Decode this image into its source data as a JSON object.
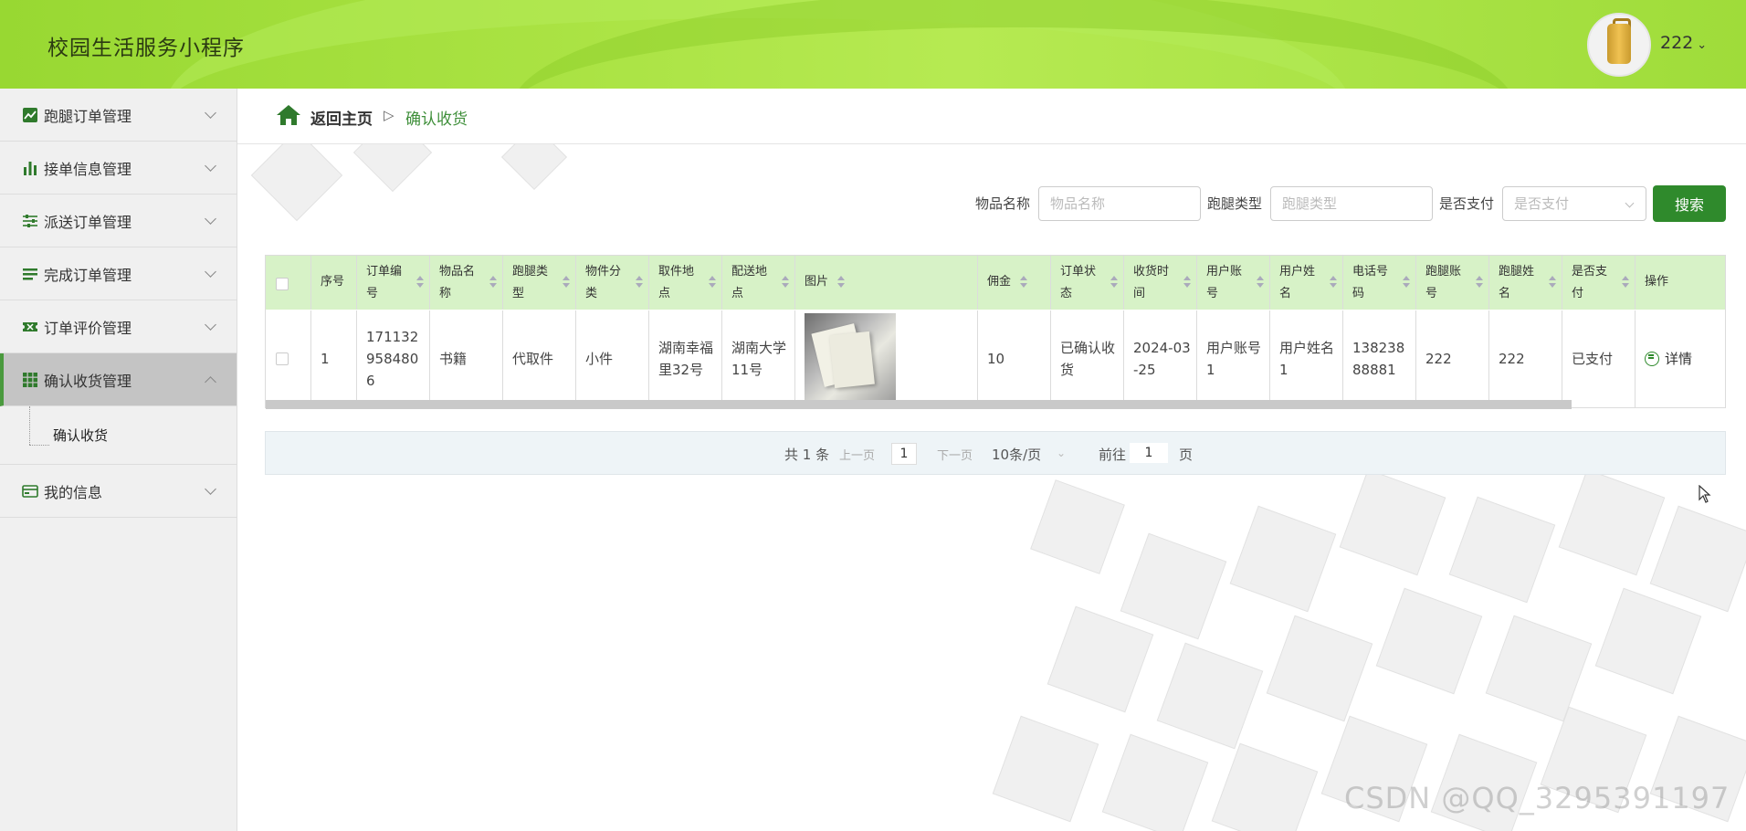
{
  "app": {
    "title": "校园生活服务小程序",
    "user": "222"
  },
  "sidebar": {
    "items": [
      {
        "label": "跑腿订单管理",
        "icon": "chart-line-icon"
      },
      {
        "label": "接单信息管理",
        "icon": "bar-chart-icon"
      },
      {
        "label": "派送订单管理",
        "icon": "sliders-icon"
      },
      {
        "label": "完成订单管理",
        "icon": "list-icon"
      },
      {
        "label": "订单评价管理",
        "icon": "ticket-icon"
      },
      {
        "label": "确认收货管理",
        "icon": "grid-icon"
      },
      {
        "label": "我的信息",
        "icon": "card-icon"
      }
    ],
    "subitem": "确认收货"
  },
  "breadcrumb": {
    "home": "返回主页",
    "sep": "▷",
    "current": "确认收货"
  },
  "search": {
    "name_label": "物品名称",
    "name_placeholder": "物品名称",
    "type_label": "跑腿类型",
    "type_placeholder": "跑腿类型",
    "paid_label": "是否支付",
    "paid_placeholder": "是否支付",
    "button": "搜索"
  },
  "table": {
    "headers": [
      "序号",
      "订单编号",
      "物品名称",
      "跑腿类型",
      "物件分类",
      "取件地点",
      "配送地点",
      "图片",
      "佣金",
      "订单状态",
      "收货时间",
      "用户账号",
      "用户姓名",
      "电话号码",
      "跑腿账号",
      "跑腿姓名",
      "是否支付",
      "操作"
    ],
    "row": {
      "index": "1",
      "order_no": "1711329584806",
      "item_name": "书籍",
      "errand_type": "代取件",
      "category": "小件",
      "pickup": "湖南幸福里32号",
      "delivery": "湖南大学11号",
      "commission": "10",
      "status": "已确认收货",
      "receive_time": "2024-03-25",
      "user_account": "用户账号1",
      "user_name": "用户姓名1",
      "phone": "13823888881",
      "runner_account": "222",
      "runner_name": "222",
      "paid": "已支付",
      "action": "详情"
    }
  },
  "pagination": {
    "total": "共 1 条",
    "prev": "上一页",
    "page": "1",
    "next": "下一页",
    "page_size": "10条/页",
    "goto_label": "前往",
    "goto_value": "1",
    "goto_suffix": "页"
  },
  "watermark": "CSDN @QQ_3295391197",
  "colors": {
    "accent": "#2f8a2c",
    "header": "#a9e242",
    "table_header": "#d7f2c7"
  }
}
